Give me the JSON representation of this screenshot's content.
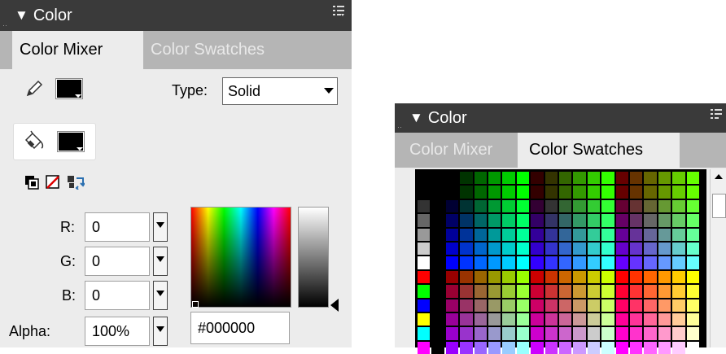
{
  "left_panel": {
    "title": "Color",
    "tabs": [
      {
        "label": "Color Mixer",
        "active": true
      },
      {
        "label": "Color Swatches",
        "active": false
      }
    ],
    "type_label": "Type:",
    "type_value": "Solid",
    "stroke_color": "#000000",
    "fill_color": "#000000",
    "channels": [
      {
        "label": "R:",
        "value": "0"
      },
      {
        "label": "G:",
        "value": "0"
      },
      {
        "label": "B:",
        "value": "0"
      },
      {
        "label": "Alpha:",
        "value": "100%"
      }
    ],
    "hex_value": "#000000"
  },
  "right_panel": {
    "title": "Color",
    "tabs": [
      {
        "label": "Color Mixer",
        "active": false
      },
      {
        "label": "Color Swatches",
        "active": true
      }
    ],
    "grays": [
      "#000000",
      "#333333",
      "#666666",
      "#999999",
      "#cccccc",
      "#ffffff"
    ],
    "primaries": [
      "#ff0000",
      "#00ff00",
      "#0000ff",
      "#ffff00",
      "#00ffff",
      "#ff00ff"
    ]
  },
  "icons": {
    "panel_menu": "panel-menu-icon",
    "stroke": "pencil-icon",
    "fill": "paint-bucket-icon",
    "black_white": "black-white-icon",
    "no_color": "no-color-icon",
    "swap": "swap-colors-icon"
  }
}
